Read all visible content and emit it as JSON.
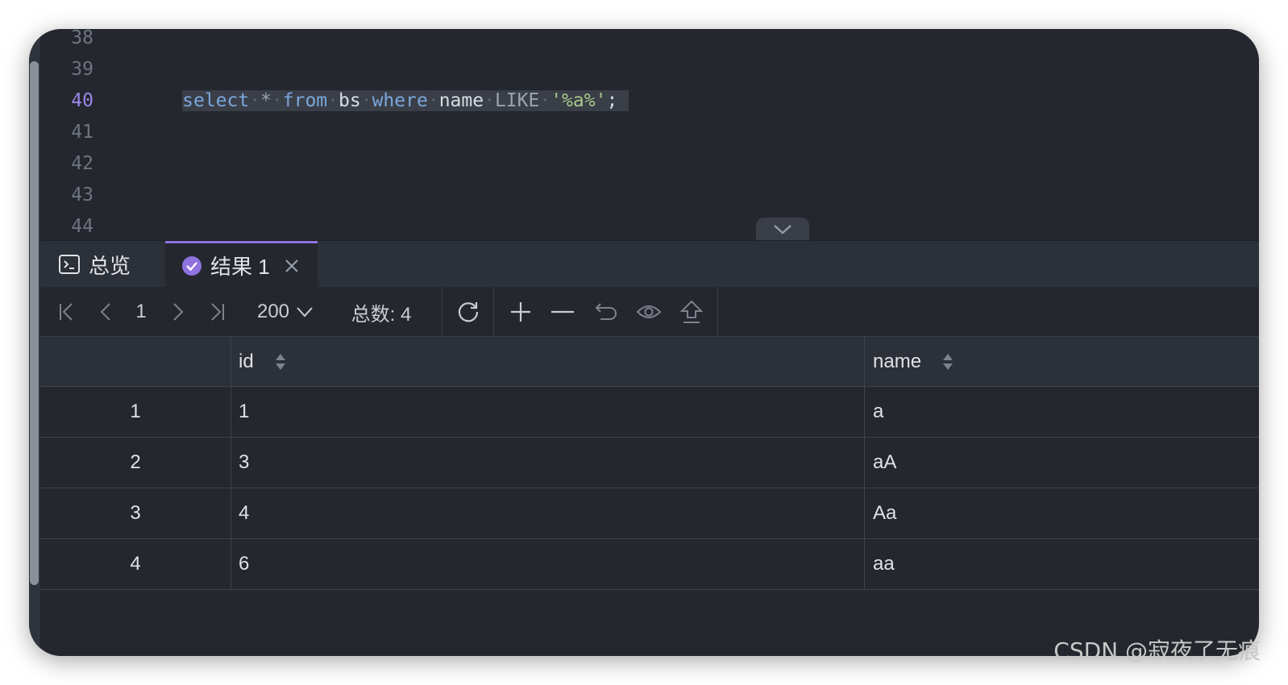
{
  "editor": {
    "line_numbers": [
      "38",
      "39",
      "40",
      "41",
      "42",
      "43",
      "44"
    ],
    "active_line": "40",
    "code": {
      "kw_select": "select",
      "star": "*",
      "kw_from": "from",
      "table": "bs",
      "kw_where": "where",
      "column": "name",
      "kw_like": "LIKE",
      "pattern": "'%a%'",
      "terminator": ";"
    }
  },
  "tabs": {
    "overview": "总览",
    "result": "结果 1"
  },
  "toolbar": {
    "page": "1",
    "page_size": "200",
    "total": "总数: 4"
  },
  "table": {
    "columns": [
      "id",
      "name"
    ],
    "rows": [
      {
        "index": "1",
        "id": "1",
        "name": "a"
      },
      {
        "index": "2",
        "id": "3",
        "name": "aA"
      },
      {
        "index": "3",
        "id": "4",
        "name": "Aa"
      },
      {
        "index": "4",
        "id": "6",
        "name": "aa"
      }
    ]
  },
  "watermark": "CSDN @寂夜了无痕",
  "colors": {
    "accent": "#8f72e0",
    "background": "#24272e",
    "keyword": "#7aa6db",
    "string": "#a6c98a"
  }
}
